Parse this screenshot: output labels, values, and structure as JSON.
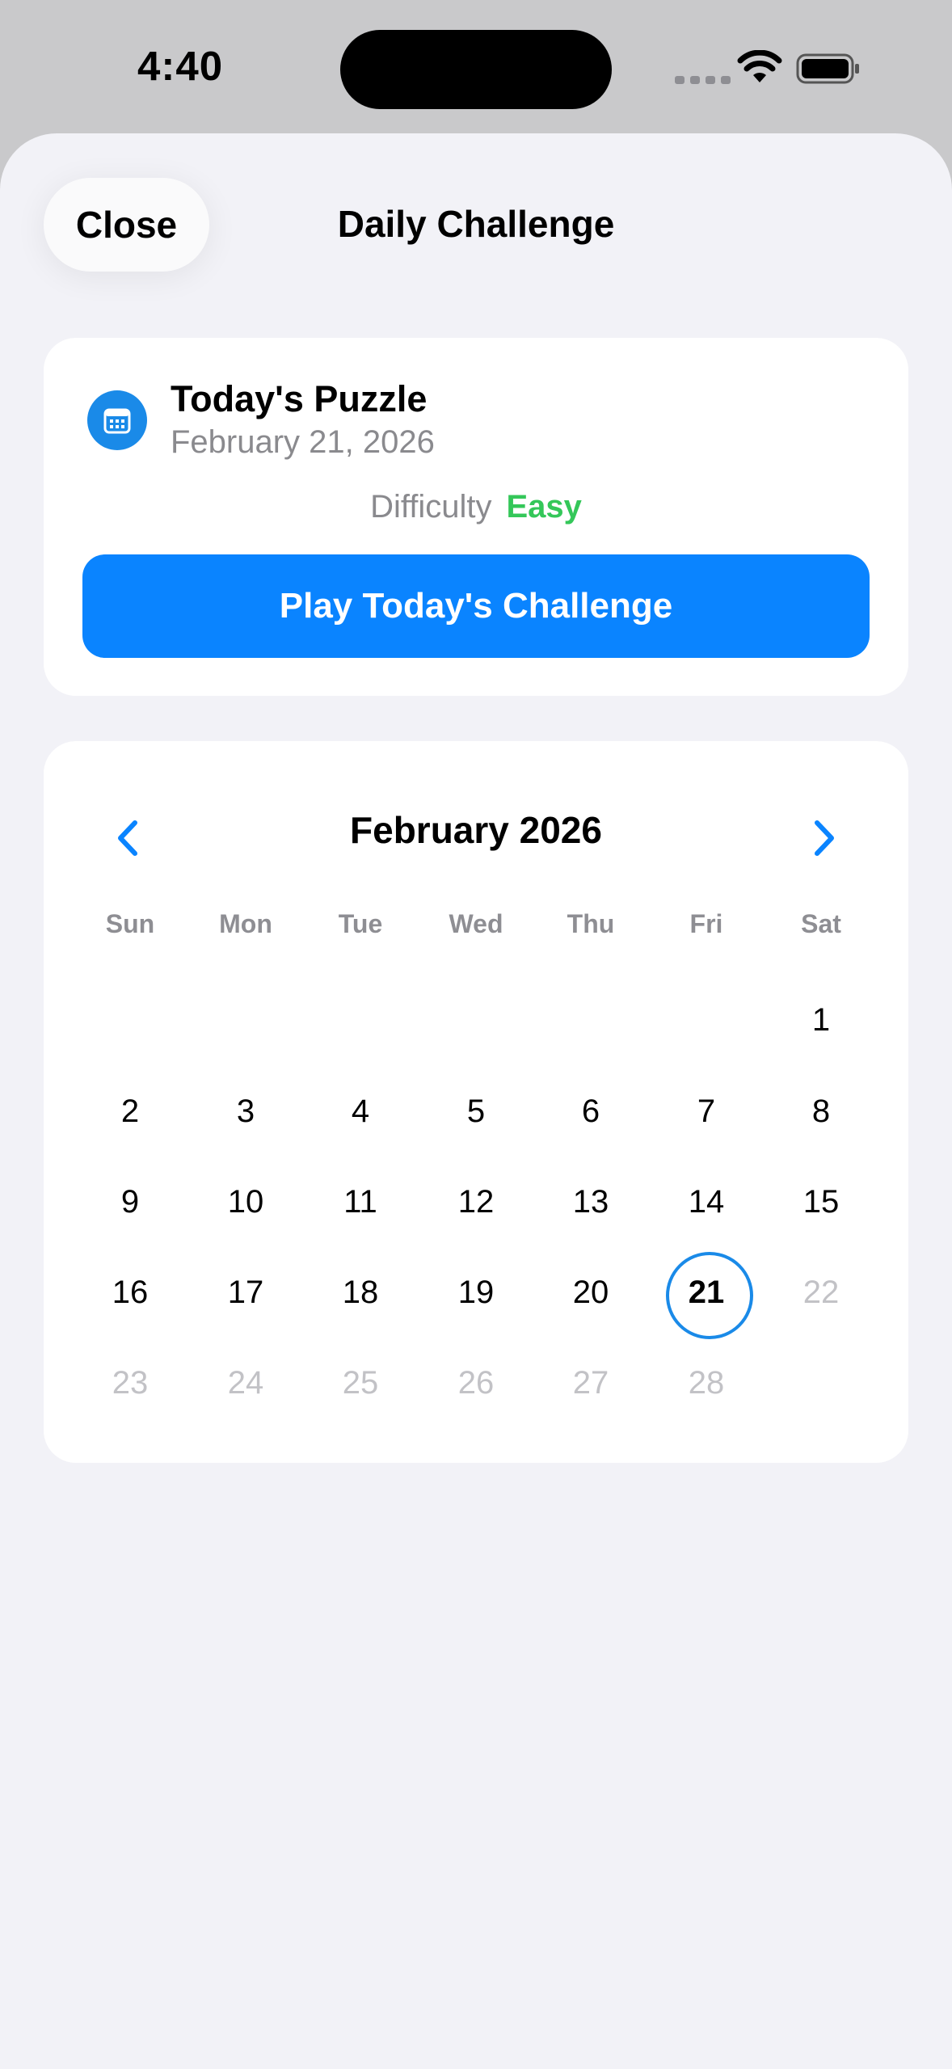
{
  "status_bar": {
    "time": "4:40"
  },
  "header": {
    "close_label": "Close",
    "title": "Daily Challenge"
  },
  "puzzle_card": {
    "icon": "calendar-icon",
    "title": "Today's Puzzle",
    "date": "February 21, 2026",
    "difficulty_label": "Difficulty",
    "difficulty_value": "Easy",
    "play_label": "Play Today's Challenge"
  },
  "calendar": {
    "month_title": "February 2026",
    "prev_icon": "chevron-left-icon",
    "next_icon": "chevron-right-icon",
    "weekdays": [
      "Sun",
      "Mon",
      "Tue",
      "Wed",
      "Thu",
      "Fri",
      "Sat"
    ],
    "selected_day": "21",
    "weeks": [
      [
        "",
        "",
        "",
        "",
        "",
        "",
        "1"
      ],
      [
        "2",
        "3",
        "4",
        "5",
        "6",
        "7",
        "8"
      ],
      [
        "9",
        "10",
        "11",
        "12",
        "13",
        "14",
        "15"
      ],
      [
        "16",
        "17",
        "18",
        "19",
        "20",
        "21",
        "22"
      ],
      [
        "23",
        "24",
        "25",
        "26",
        "27",
        "28",
        ""
      ]
    ]
  },
  "colors": {
    "accent": "#0a84ff",
    "easy": "#34c759",
    "background": "#f2f2f7",
    "disabled_text": "#c2c2c6"
  }
}
